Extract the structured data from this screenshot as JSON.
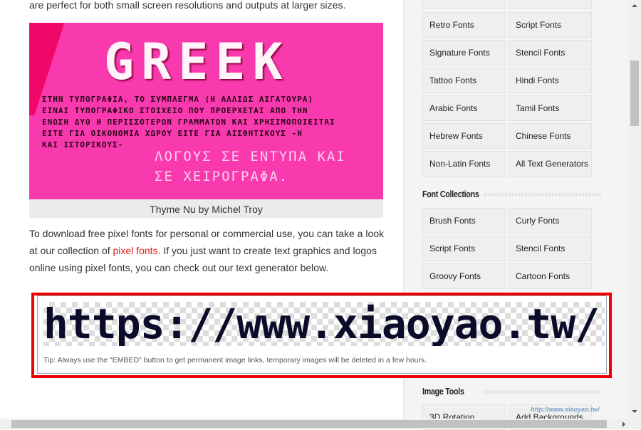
{
  "intro_tail": "are perfect for both small screen resolutions and outputs at larger sizes.",
  "image": {
    "title": "GREEK",
    "greek_body": "ΣΤΗΝ ΤΥΠΟΓΡΑΦΙΑ, ΤΟ ΣΥΜΠΛΕΓΜΑ (Η ΑΛΛΙΩΣ ΑΙΓΑΤΟΥΡΑ)\nΕΙΝΑΙ ΤΥΠΟΓΡΑΦΙΚΟ ΣΤΟΙΧΕΙΟ ΠΟΥ ΠΡΟΕΡΧΕΤΑΙ ΑΠΟ ΤΗΝ\nΕΝΩΣΗ ΔΥΟ Η ΠΕΡΙΣΣΟΤΕΡΩΝ ΓΡΑΜΜΑΤΩΝ ΚΑΙ ΧΡΗΣΙΜΟΠΟΙΕΙΤΑΙ\nΕΙΤΕ ΓΙΑ ΟΙΚΟΝΟΜΙΑ ΧΩΡΟΥ ΕΙΤΕ ΓΙΑ ΑΙΣΘΗΤΙΚΟΥΣ -Η\nΚΑΙ ΙΣΤΟΡΙΚΟΥΣ-",
    "greek_light": "ΛΟΓΟΥΣ ΣΕ ΕΝΤΥΠΑ ΚΑΙ\nΣΕ ΧΕΙΡΟΓΡΑΦΑ.",
    "caption": "Thyme Nu by Michel Troy"
  },
  "paragraph": {
    "before": "To download free pixel fonts for personal or commercial use, you can take a look at our collection of ",
    "link": "pixel fonts",
    "after": ". If you just want to create text graphics and logos online using pixel fonts, you can check out our text generator below."
  },
  "generator": {
    "text": "https://www.xiaoyao.tw/",
    "tip": "Tip: Always use the \"EMBED\" button to get permanent image links, temporary images will be deleted in a few hours."
  },
  "sidebar": {
    "top_buttons": [
      "Retro Fonts",
      "Script Fonts",
      "Signature Fonts",
      "Stencil Fonts",
      "Tattoo Fonts",
      "Hindi Fonts",
      "Arabic Fonts",
      "Tamil Fonts",
      "Hebrew Fonts",
      "Chinese Fonts",
      "Non-Latin Fonts",
      "All Text Generators"
    ],
    "collections_title": "Font Collections",
    "collections": [
      "Brush Fonts",
      "Curly Fonts",
      "Script Fonts",
      "Stencil Fonts",
      "Groovy Fonts",
      "Cartoon Fonts"
    ],
    "image_tools_title": "Image Tools",
    "image_tools": [
      "3D Rotation",
      "Add Backgrounds"
    ]
  },
  "watermark": "http://www.xiaoyao.tw/",
  "colors": {
    "link": "#e0201b",
    "pink": "#f93aaf",
    "highlight": "#e00000"
  }
}
